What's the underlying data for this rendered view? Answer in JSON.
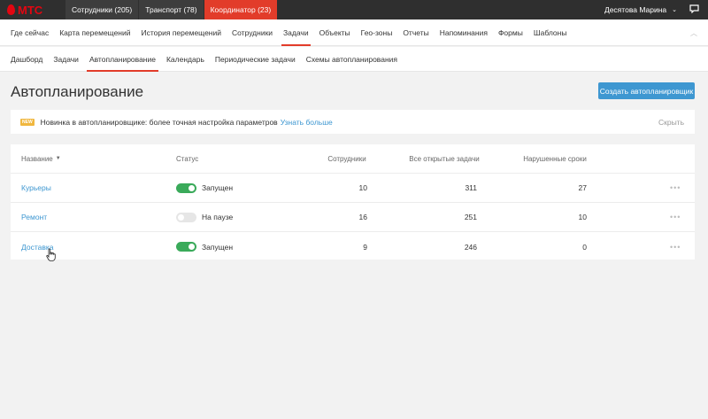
{
  "brand": {
    "logo_text": "МТС",
    "accent": "#e30611"
  },
  "top_tabs": [
    {
      "label": "Сотрудники (205)",
      "active": false
    },
    {
      "label": "Транспорт (78)",
      "active": false
    },
    {
      "label": "Координатор (23)",
      "active": true
    }
  ],
  "user": {
    "name": "Десятова Марина",
    "menu_icon": "chevron-down-icon",
    "chat_icon": "chat-icon"
  },
  "main_nav": [
    "Где сейчас",
    "Карта перемещений",
    "История перемещений",
    "Сотрудники",
    "Задачи",
    "Объекты",
    "Гео-зоны",
    "Отчеты",
    "Напоминания",
    "Формы",
    "Шаблоны"
  ],
  "main_nav_active": 4,
  "sub_nav": [
    "Дашборд",
    "Задачи",
    "Автопланирование",
    "Календарь",
    "Периодические задачи",
    "Схемы автопланирования"
  ],
  "sub_nav_active": 2,
  "page": {
    "title": "Автопланирование",
    "create_button": "Создать автопланировщик"
  },
  "notice": {
    "badge": "NEW",
    "text": "Новинка в автопланировщике: более точная настройка параметров",
    "link": "Узнать больше",
    "hide": "Скрыть"
  },
  "table": {
    "headers": {
      "name": "Название",
      "status": "Статус",
      "employees": "Сотрудники",
      "open_tasks": "Все открытые задачи",
      "overdue": "Нарушенные сроки"
    },
    "rows": [
      {
        "name": "Курьеры",
        "status": "Запущен",
        "on": true,
        "employees": "10",
        "open_tasks": "311",
        "overdue": "27"
      },
      {
        "name": "Ремонт",
        "status": "На паузе",
        "on": false,
        "employees": "16",
        "open_tasks": "251",
        "overdue": "10"
      },
      {
        "name": "Доставка",
        "status": "Запущен",
        "on": true,
        "employees": "9",
        "open_tasks": "246",
        "overdue": "0"
      }
    ],
    "more_glyph": "•••"
  },
  "colors": {
    "link": "#3e97d1",
    "active_tab": "#e23c2a",
    "toggle_on": "#3aaa5a",
    "button": "#3e97d1"
  }
}
